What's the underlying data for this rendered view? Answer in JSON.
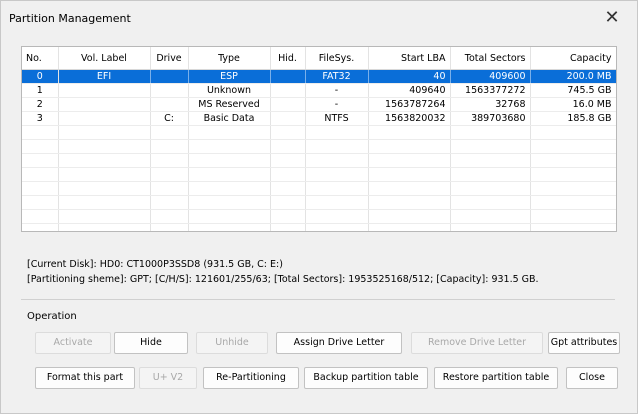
{
  "window": {
    "title": "Partition Management",
    "close_glyph": "✕"
  },
  "table": {
    "columns": [
      "No.",
      "Vol. Label",
      "Drive",
      "Type",
      "Hid.",
      "FileSys.",
      "Start LBA",
      "Total Sectors",
      "Capacity"
    ],
    "rows": [
      [
        "0",
        "EFI",
        "",
        "ESP",
        "",
        "FAT32",
        "40",
        "409600",
        "200.0 MB"
      ],
      [
        "1",
        "",
        "",
        "Unknown",
        "",
        "-",
        "409640",
        "1563377272",
        "745.5 GB"
      ],
      [
        "2",
        "",
        "",
        "MS Reserved",
        "",
        "-",
        "1563787264",
        "32768",
        "16.0 MB"
      ],
      [
        "3",
        "",
        "C:",
        "Basic Data",
        "",
        "NTFS",
        "1563820032",
        "389703680",
        "185.8 GB"
      ]
    ],
    "selected_row": 0
  },
  "info": {
    "current_disk_label": "[Current Disk]:",
    "current_disk_value": "HD0: CT1000P3SSD8 (931.5 GB, C: E:)",
    "scheme_label": "[Partitioning sheme]:",
    "scheme_value": "GPT;",
    "scheme_details": "[C/H/S]: 121601/255/63; [Total Sectors]: 1953525168/512; [Capacity]: 931.5 GB."
  },
  "operation": {
    "label": "Operation",
    "activate": "Activate",
    "hide": "Hide",
    "unhide": "Unhide",
    "assign_drive_letter": "Assign Drive Letter",
    "remove_drive_letter": "Remove Drive Letter",
    "gpt_attributes": "Gpt attributes",
    "format_this_part": "Format this part",
    "u_v2": "U+ V2",
    "re_partitioning": "Re-Partitioning",
    "backup_partition_table": "Backup partition table",
    "restore_partition_table": "Restore partition table",
    "close": "Close"
  },
  "colors": {
    "selection": "#0a6ed8",
    "disabled_text": "#a8a8a8"
  }
}
